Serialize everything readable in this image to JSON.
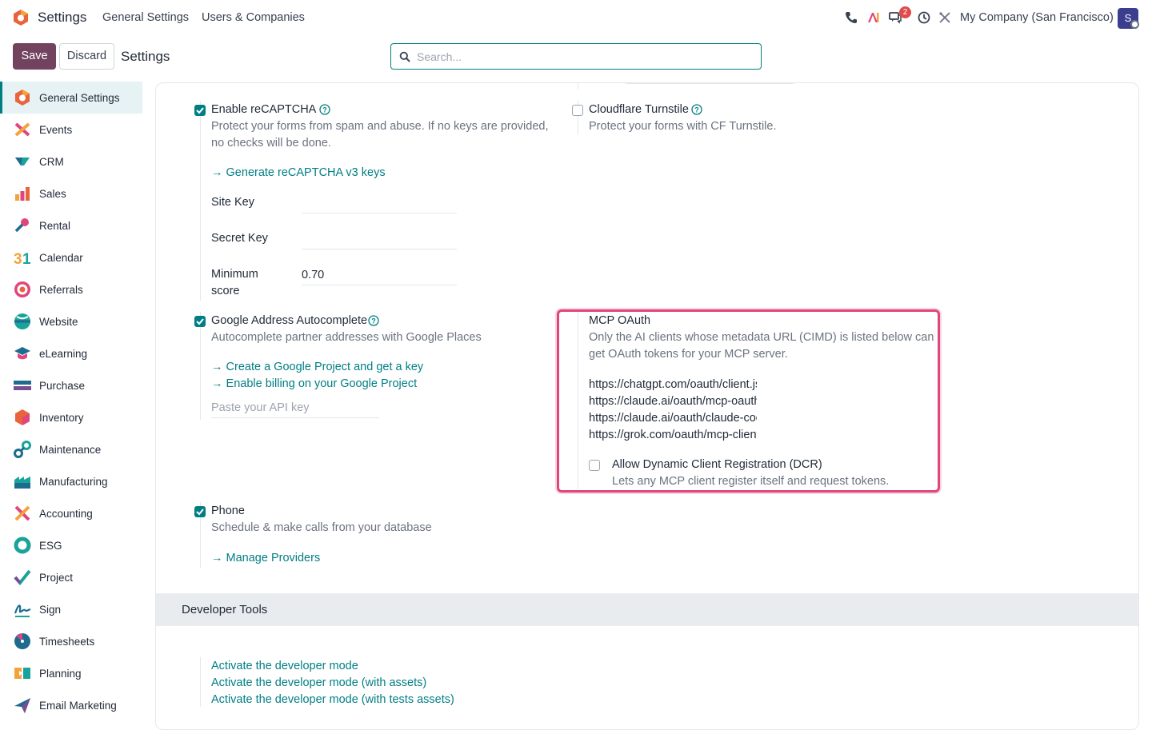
{
  "navbar": {
    "app_title": "Settings",
    "menu": [
      "General Settings",
      "Users & Companies"
    ],
    "notification_count": "2",
    "company": "My Company (San Francisco)",
    "avatar_initial": "S"
  },
  "control_panel": {
    "save_label": "Save",
    "discard_label": "Discard",
    "breadcrumb": "Settings",
    "search_placeholder": "Search..."
  },
  "sidebar": {
    "items": [
      {
        "label": "General Settings",
        "icon": "settings-icon",
        "active": true
      },
      {
        "label": "Events",
        "icon": "events-icon"
      },
      {
        "label": "CRM",
        "icon": "crm-icon"
      },
      {
        "label": "Sales",
        "icon": "sales-icon"
      },
      {
        "label": "Rental",
        "icon": "rental-icon"
      },
      {
        "label": "Calendar",
        "icon": "calendar-icon"
      },
      {
        "label": "Referrals",
        "icon": "referrals-icon"
      },
      {
        "label": "Website",
        "icon": "website-icon"
      },
      {
        "label": "eLearning",
        "icon": "elearning-icon"
      },
      {
        "label": "Purchase",
        "icon": "purchase-icon"
      },
      {
        "label": "Inventory",
        "icon": "inventory-icon"
      },
      {
        "label": "Maintenance",
        "icon": "maintenance-icon"
      },
      {
        "label": "Manufacturing",
        "icon": "manufacturing-icon"
      },
      {
        "label": "Accounting",
        "icon": "accounting-icon"
      },
      {
        "label": "ESG",
        "icon": "esg-icon"
      },
      {
        "label": "Project",
        "icon": "project-icon"
      },
      {
        "label": "Sign",
        "icon": "sign-icon"
      },
      {
        "label": "Timesheets",
        "icon": "timesheets-icon"
      },
      {
        "label": "Planning",
        "icon": "planning-icon"
      },
      {
        "label": "Email Marketing",
        "icon": "email-marketing-icon"
      }
    ]
  },
  "recaptcha": {
    "title": "Enable reCAPTCHA",
    "checked": true,
    "desc_line1": "Protect your forms from spam and abuse. If no keys are provided,",
    "desc_line2": "no checks will be done.",
    "link": "Generate reCAPTCHA v3 keys",
    "site_key_label": "Site Key",
    "site_key_value": "",
    "secret_key_label": "Secret Key",
    "secret_key_value": "",
    "min_score_label_1": "Minimum",
    "min_score_label_2": "score",
    "min_score_value": "0.70"
  },
  "turnstile": {
    "title": "Cloudflare Turnstile",
    "checked": false,
    "desc": "Protect your forms with CF Turnstile."
  },
  "google_address": {
    "title": "Google Address Autocomplete",
    "checked": true,
    "desc": "Autocomplete partner addresses with Google Places",
    "link1": "Create a Google Project and get a key",
    "link2": "Enable billing on your Google Project",
    "api_key_placeholder": "Paste your API key"
  },
  "mcp_oauth": {
    "title": "MCP OAuth",
    "desc_line1": "Only the AI clients whose metadata URL (CIMD) is listed below can",
    "desc_line2": "get OAuth tokens for your MCP server.",
    "urls": [
      "https://chatgpt.com/oauth/client.json",
      "https://claude.ai/oauth/mcp-oauth-client",
      "https://claude.ai/oauth/claude-code-client",
      "https://grok.com/oauth/mcp-client.json"
    ],
    "dcr_title": "Allow Dynamic Client Registration (DCR)",
    "dcr_checked": false,
    "dcr_desc": "Lets any MCP client register itself and request tokens."
  },
  "phone": {
    "title": "Phone",
    "checked": true,
    "desc": "Schedule & make calls from your database",
    "link": "Manage Providers"
  },
  "developer_tools": {
    "title": "Developer Tools",
    "links": [
      "Activate the developer mode",
      "Activate the developer mode (with assets)",
      "Activate the developer mode (with tests assets)"
    ]
  },
  "colors": {
    "primary": "#71435f",
    "accent": "#017e84",
    "highlight": "#e0457b"
  }
}
